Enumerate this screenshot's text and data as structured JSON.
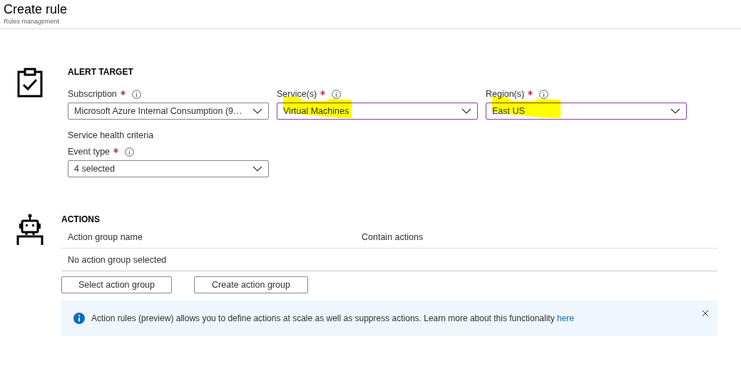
{
  "header": {
    "title": "Create rule",
    "subtitle": "Rules management"
  },
  "alert_target": {
    "heading": "ALERT TARGET",
    "fields": [
      {
        "label": "Subscription",
        "required": true,
        "value": "Microsoft Azure Internal Consumption (9…",
        "focused": false,
        "marked": false
      },
      {
        "label": "Service(s)",
        "required": true,
        "value": "Virtual Machines",
        "focused": true,
        "marked": true
      },
      {
        "label": "Region(s)",
        "required": true,
        "value": "East US",
        "focused": true,
        "marked": true
      }
    ],
    "criteria_heading": "Service health criteria",
    "event_type": {
      "label": "Event type",
      "required": true,
      "value": "4 selected",
      "focused": false,
      "marked": false
    }
  },
  "actions": {
    "heading": "ACTIONS",
    "table": {
      "columns": [
        "Action group name",
        "Contain actions"
      ],
      "empty_text": "No action group selected"
    },
    "buttons": [
      "Select action group",
      "Create action group"
    ],
    "info": {
      "text": "Action rules (preview) allows you to define actions at scale as well as suppress actions. Learn more about this functionality",
      "link": "here"
    }
  }
}
